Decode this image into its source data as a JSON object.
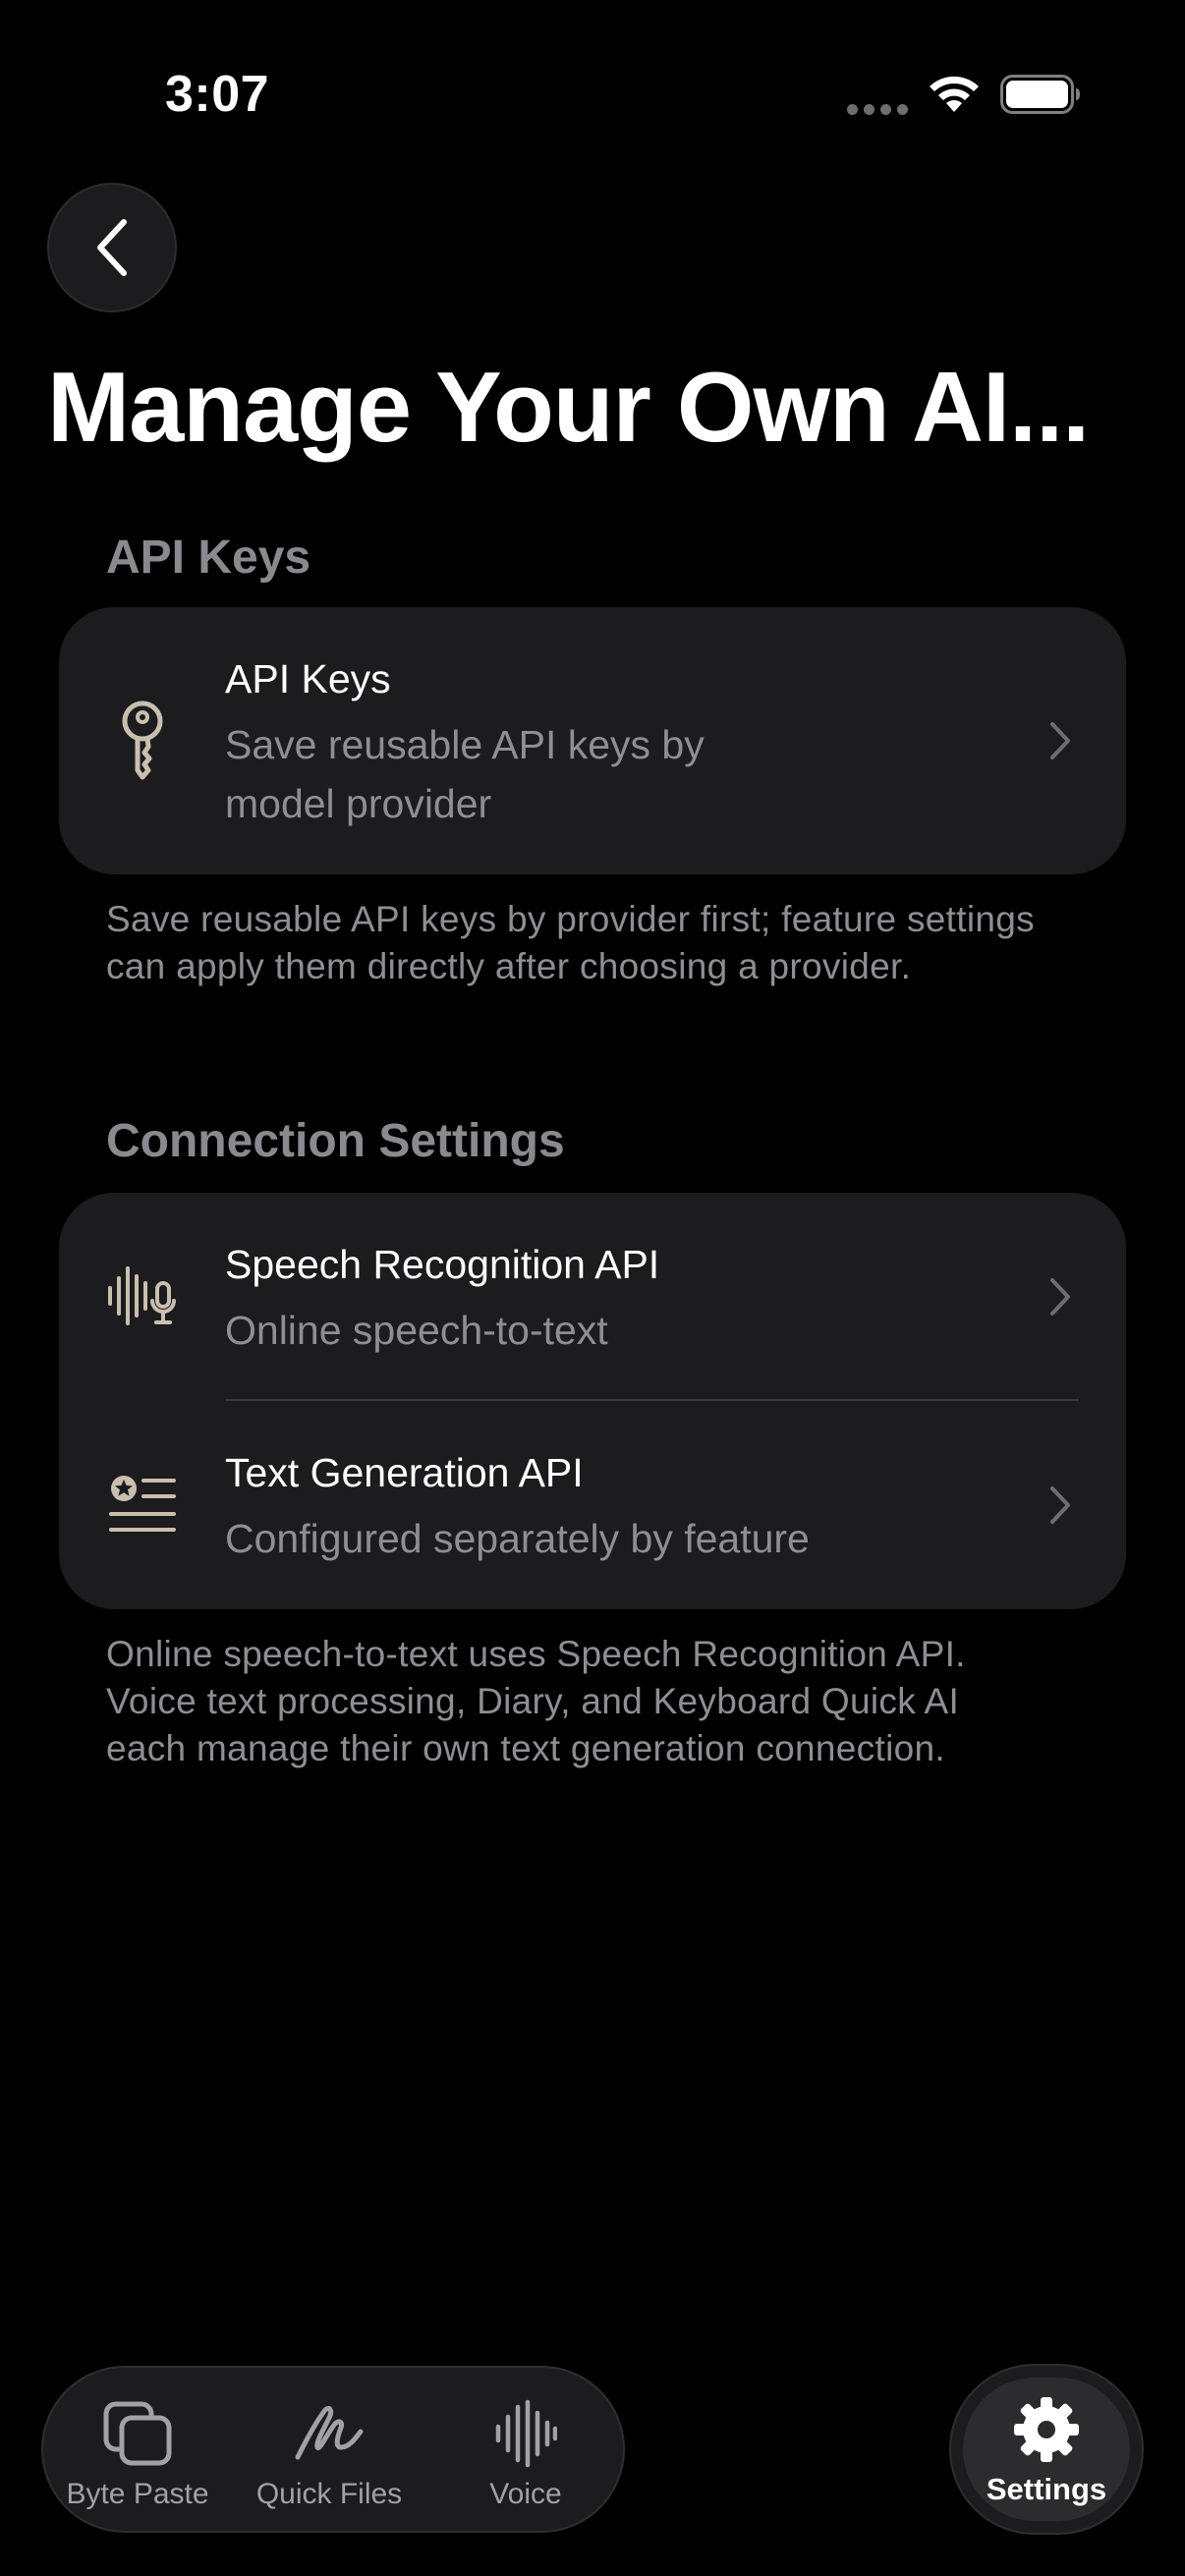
{
  "status_bar": {
    "time": "3:07"
  },
  "page": {
    "title": "Manage Your Own AI..."
  },
  "sections": {
    "api_keys": {
      "header": "API Keys",
      "row": {
        "title": "API Keys",
        "subtitle_line1": "Save reusable API keys by",
        "subtitle_line2": "model provider",
        "icon": "key-icon"
      },
      "footnote": "Save reusable API keys by provider first; feature settings can apply them directly after choosing a provider."
    },
    "connection_settings": {
      "header": "Connection Settings",
      "rows": [
        {
          "title": "Speech Recognition API",
          "subtitle": "Online speech-to-text",
          "icon": "waveform-mic-icon"
        },
        {
          "title": "Text Generation API",
          "subtitle": "Configured separately by feature",
          "icon": "text-badge-star-icon"
        }
      ],
      "footnote": "Online speech-to-text uses Speech Recognition API. Voice text processing, Diary, and Keyboard Quick AI each manage their own text generation connection."
    }
  },
  "tab_bar": {
    "items": [
      {
        "label": "Byte Paste",
        "icon": "copy-icon"
      },
      {
        "label": "Quick Files",
        "icon": "scribble-icon"
      },
      {
        "label": "Voice",
        "icon": "waveform-icon"
      }
    ],
    "settings": {
      "label": "Settings",
      "icon": "gear-icon"
    }
  },
  "colors": {
    "background": "#000000",
    "card": "#1c1c1e",
    "secondary_text": "#8e8e93",
    "icon_tint": "#c9bfae"
  }
}
